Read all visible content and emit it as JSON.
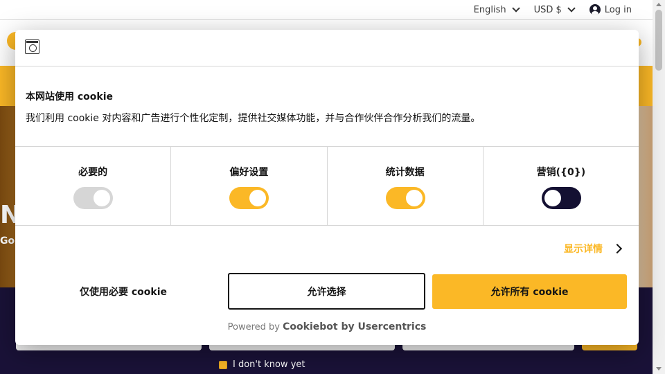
{
  "topbar": {
    "language": "English",
    "currency": "USD $",
    "login": "Log in"
  },
  "background": {
    "hero_text": "N",
    "hero_sub": "Go",
    "checkbox_label": "I don't know yet"
  },
  "cookie_dialog": {
    "title": "本网站使用 cookie",
    "description": "我们利用 cookie 对内容和广告进行个性化定制，提供社交媒体功能，并与合作伙伴合作分析我们的流量。",
    "toggles": [
      {
        "label": "必要的",
        "state": "on-disabled"
      },
      {
        "label": "偏好设置",
        "state": "on"
      },
      {
        "label": "统计数据",
        "state": "on"
      },
      {
        "label": "营销({0})",
        "state": "off"
      }
    ],
    "show_details": "显示详情",
    "buttons": {
      "deny": "仅使用必要 cookie",
      "allow_selection": "允许选择",
      "allow_all": "允许所有 cookie"
    },
    "powered_prefix": "Powered by",
    "powered_brand": "Cookiebot by Usercentrics"
  },
  "colors": {
    "accent": "#fbb826",
    "dark": "#141032",
    "text": "#141414"
  }
}
